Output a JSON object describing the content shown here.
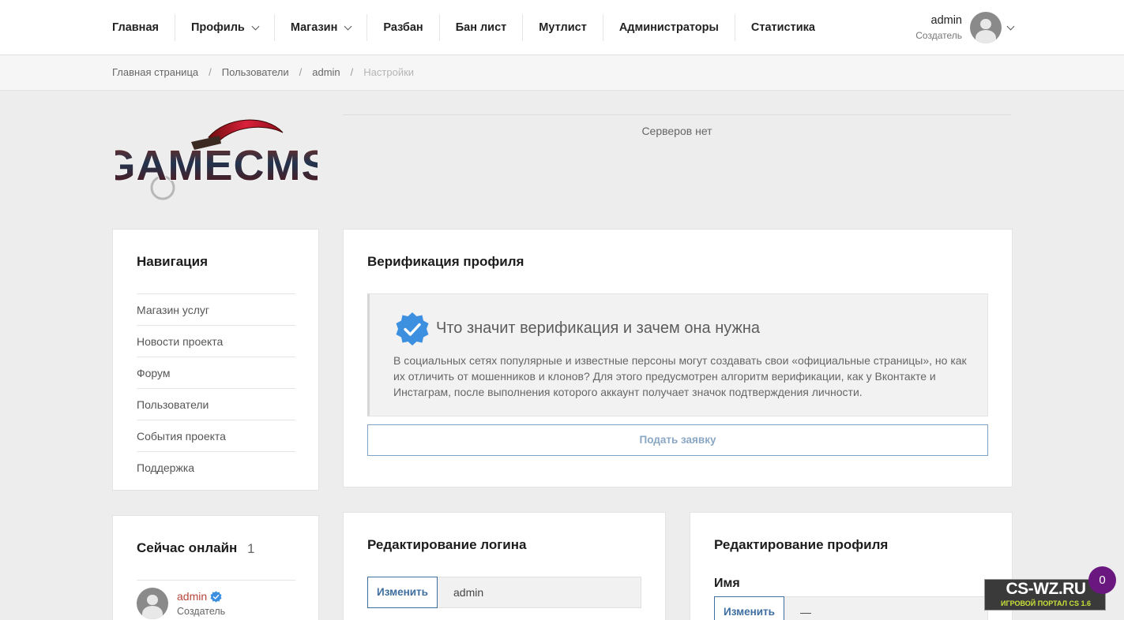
{
  "nav": {
    "items": [
      {
        "label": "Главная",
        "dropdown": false
      },
      {
        "label": "Профиль",
        "dropdown": true
      },
      {
        "label": "Магазин",
        "dropdown": true
      },
      {
        "label": "Разбан",
        "dropdown": false
      },
      {
        "label": "Бан лист",
        "dropdown": false
      },
      {
        "label": "Мутлист",
        "dropdown": false
      },
      {
        "label": "Администраторы",
        "dropdown": false
      },
      {
        "label": "Статистика",
        "dropdown": false
      }
    ]
  },
  "user": {
    "name": "admin",
    "role": "Создатель"
  },
  "breadcrumb": [
    "Главная страница",
    "Пользователи",
    "admin",
    "Настройки"
  ],
  "logo": {
    "text": "GAMECMS"
  },
  "servers": {
    "text": "Серверов нет"
  },
  "navigation": {
    "title": "Навигация",
    "items": [
      "Магазин услуг",
      "Новости проекта",
      "Форум",
      "Пользователи",
      "События проекта",
      "Поддержка"
    ]
  },
  "verification": {
    "title": "Верификация профиля",
    "notice_title": "Что значит верификация и зачем она нужна",
    "notice_text": "В социальных сетях популярные и известные персоны могут создавать свои «официальные страницы», но как их отличить от мошенников и клонов? Для этого предусмотрен алгоритм верификации, как у Вконтакте и Инстаграм, после выполнения которого аккаунт получает значок подтверждения личности.",
    "button": "Подать заявку"
  },
  "online": {
    "title": "Сейчас онлайн",
    "count": "1",
    "users": [
      {
        "name": "admin",
        "role": "Создатель"
      }
    ]
  },
  "login_edit": {
    "title": "Редактирование логина",
    "button": "Изменить",
    "value": "admin"
  },
  "profile_edit": {
    "title": "Редактирование профиля",
    "field_label": "Имя",
    "button": "Изменить",
    "value": "—"
  },
  "watermark": {
    "top": "CS-WZ.RU",
    "bottom": "ИГРОВОЙ ПОРТАЛ CS 1.6"
  },
  "counter": "0",
  "colors": {
    "accent": "#3f6fa0",
    "verified": "#3d8fe0",
    "online_name": "#b6463a",
    "counter_bg": "#6a1880"
  }
}
